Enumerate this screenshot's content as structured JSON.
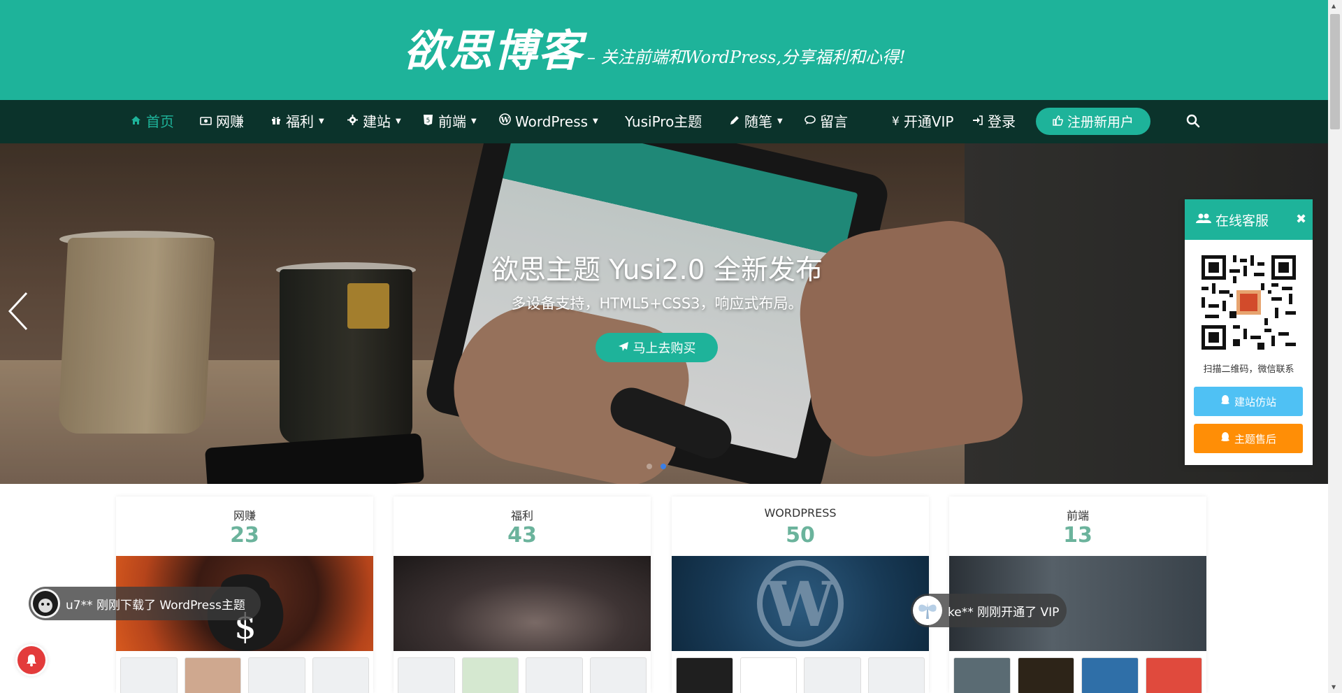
{
  "header": {
    "logo_text": "欲思博客",
    "tagline": "– 关注前端和WordPress,分享福利和心得!"
  },
  "nav": {
    "items": [
      {
        "label": "首页",
        "icon": "home-icon",
        "caret": false,
        "active": true
      },
      {
        "label": "网赚",
        "icon": "money-icon",
        "caret": false
      },
      {
        "label": "福利",
        "icon": "gift-icon",
        "caret": true
      },
      {
        "label": "建站",
        "icon": "gear-icon",
        "caret": true
      },
      {
        "label": "前端",
        "icon": "html5-icon",
        "caret": true
      },
      {
        "label": "WordPress",
        "icon": "wordpress-icon",
        "caret": true
      },
      {
        "label": "YusiPro主题",
        "icon": "",
        "caret": false
      },
      {
        "label": "随笔",
        "icon": "pencil-icon",
        "caret": true
      },
      {
        "label": "留言",
        "icon": "comment-icon",
        "caret": false
      }
    ],
    "vip": {
      "label": "开通VIP",
      "icon": "yen-icon"
    },
    "login": {
      "label": "登录",
      "icon": "sign-in-icon"
    },
    "register": {
      "label": "注册新用户",
      "icon": "thumbs-up-icon"
    },
    "search_icon": "search-icon"
  },
  "hero": {
    "title": "欲思主题 Yusi2.0 全新发布",
    "subtitle": "多设备支持，HTML5+CSS3，响应式布局。",
    "button": "马上去购买",
    "slides": 2,
    "active_slide": 2
  },
  "categories": [
    {
      "name": "网赚",
      "count": "23"
    },
    {
      "name": "福利",
      "count": "43"
    },
    {
      "name": "WORDPRESS",
      "count": "50"
    },
    {
      "name": "前端",
      "count": "13"
    }
  ],
  "service": {
    "title": "在线客服",
    "tip": "扫描二维码，微信联系",
    "buttons": [
      {
        "label": "建站仿站",
        "color": "#4fc1f4"
      },
      {
        "label": "主题售后",
        "color": "#ff8e06"
      }
    ]
  },
  "toasts": [
    {
      "text": "u7** 刚刚下载了 WordPress主题"
    },
    {
      "text": "ke** 刚刚开通了 VIP"
    }
  ],
  "colors": {
    "brand": "#1eb39a",
    "nav_bg": "#0b332b",
    "count": "#6bb39c",
    "bell": "#e33b3b"
  }
}
